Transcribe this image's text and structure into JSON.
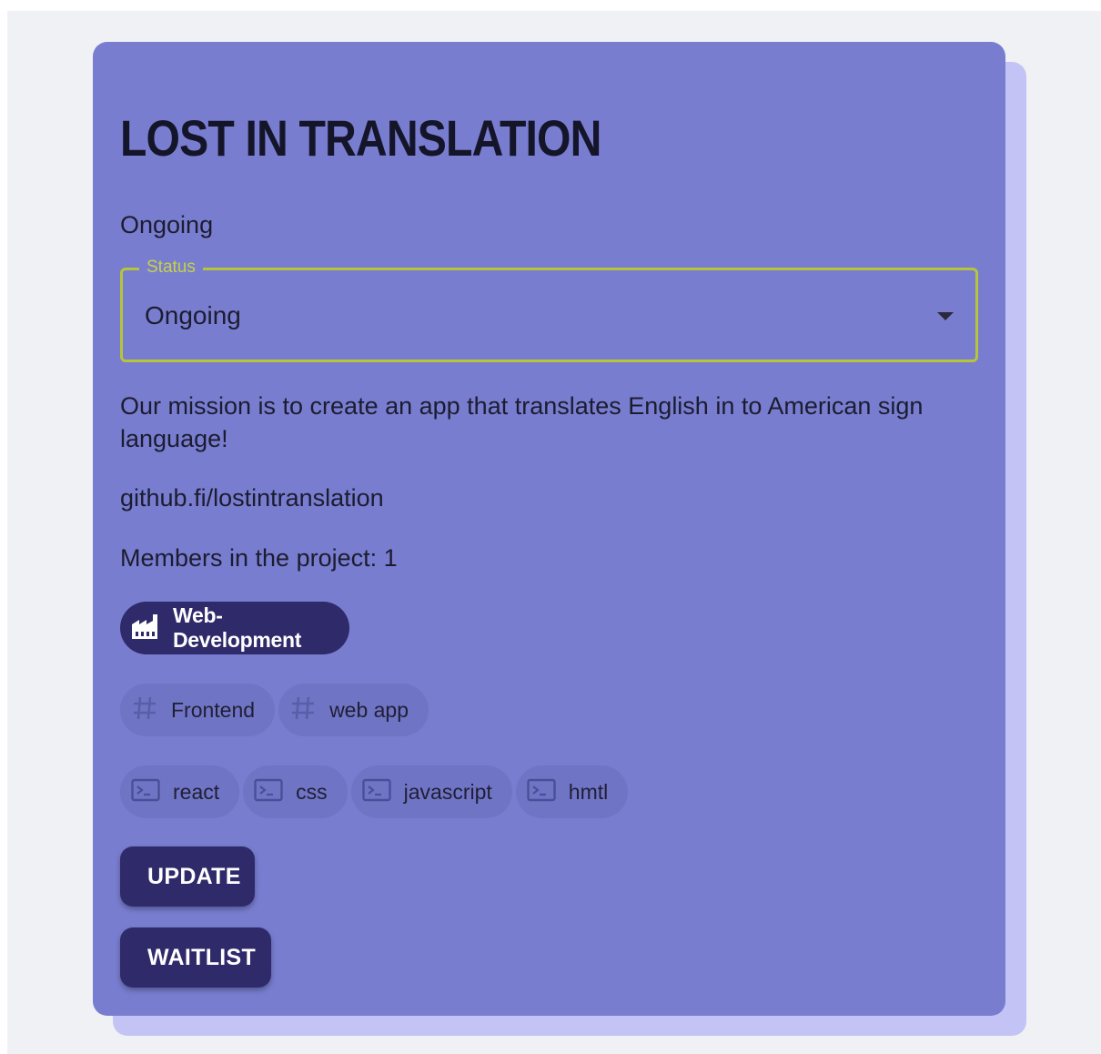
{
  "project": {
    "title": "LOST IN TRANSLATION",
    "status_text": "Ongoing",
    "status_field": {
      "label": "Status",
      "value": "Ongoing"
    },
    "description": "Our mission is to create an app that translates English in to American sign language!",
    "link": "github.fi/lostintranslation",
    "members": "Members in the project: 1"
  },
  "category_chip": {
    "label": "Web-Development",
    "icon": "factory-icon"
  },
  "tags": [
    {
      "label": "Frontend",
      "icon": "hash-icon"
    },
    {
      "label": "web app",
      "icon": "hash-icon"
    }
  ],
  "technologies": [
    {
      "label": "react",
      "icon": "terminal-icon"
    },
    {
      "label": "css",
      "icon": "terminal-icon"
    },
    {
      "label": "javascript",
      "icon": "terminal-icon"
    },
    {
      "label": "hmtl",
      "icon": "terminal-icon"
    }
  ],
  "actions": {
    "update_label": "UPDATE",
    "waitlist_label": "WAITLIST"
  },
  "colors": {
    "page_background": "#f0f1f5",
    "card_background": "#787dcf",
    "card_shadow": "#c3c3f5",
    "accent_outline": "#b7c43a",
    "button_background": "#2f2a6a",
    "chip_background": "#7074c4"
  }
}
